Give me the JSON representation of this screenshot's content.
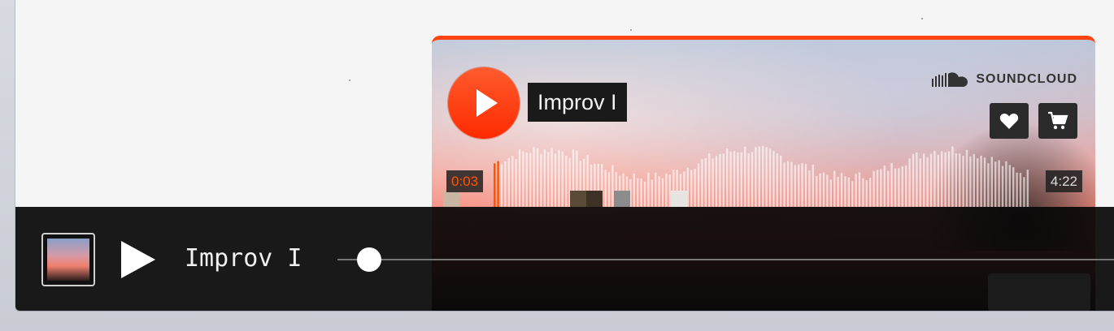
{
  "widget": {
    "track_title": "Improv I",
    "brand": "SOUNDCLOUD",
    "current_time": "0:03",
    "duration": "4:22",
    "accent_color": "#ff5500",
    "icons": [
      "play-icon",
      "soundcloud-logo-icon",
      "heart-icon",
      "cart-icon"
    ],
    "progress_fraction": 0.011
  },
  "player_bar": {
    "track_title": "Improv I",
    "progress_fraction": 0.011,
    "icons": [
      "play-icon"
    ]
  }
}
